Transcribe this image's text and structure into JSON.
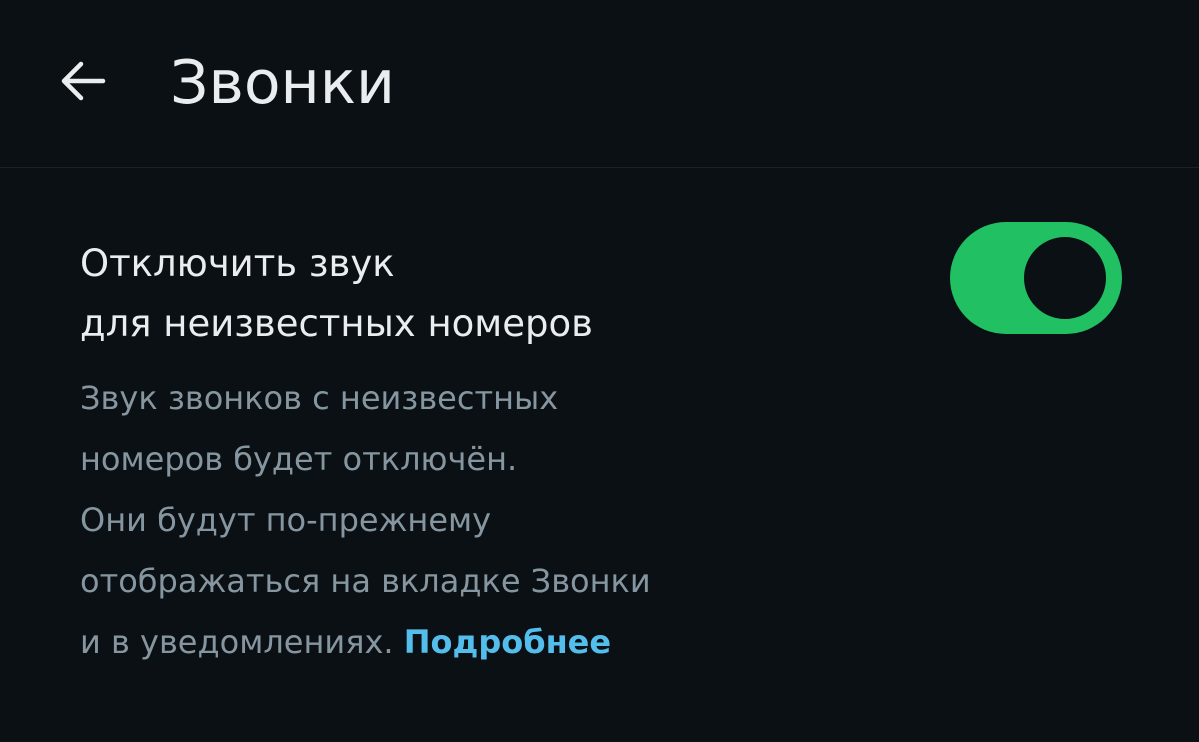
{
  "header": {
    "back_icon": "arrow-left-icon",
    "title": "Звонки"
  },
  "setting": {
    "title_line1": "Отключить звук",
    "title_line2": "для неизвестных номеров",
    "description_lines": [
      "Звук звонков с неизвестных",
      "номеров будет отключён.",
      "Они будут по-прежнему",
      "отображаться на вкладке Звонки"
    ],
    "description_last": "и в уведомлениях. ",
    "learn_more": "Подробнее",
    "toggle_on": true
  },
  "colors": {
    "background": "#0b1014",
    "primary_text": "#e9edef",
    "secondary_text": "#8696a0",
    "accent_green": "#21c063",
    "link_blue": "#53bdeb"
  }
}
